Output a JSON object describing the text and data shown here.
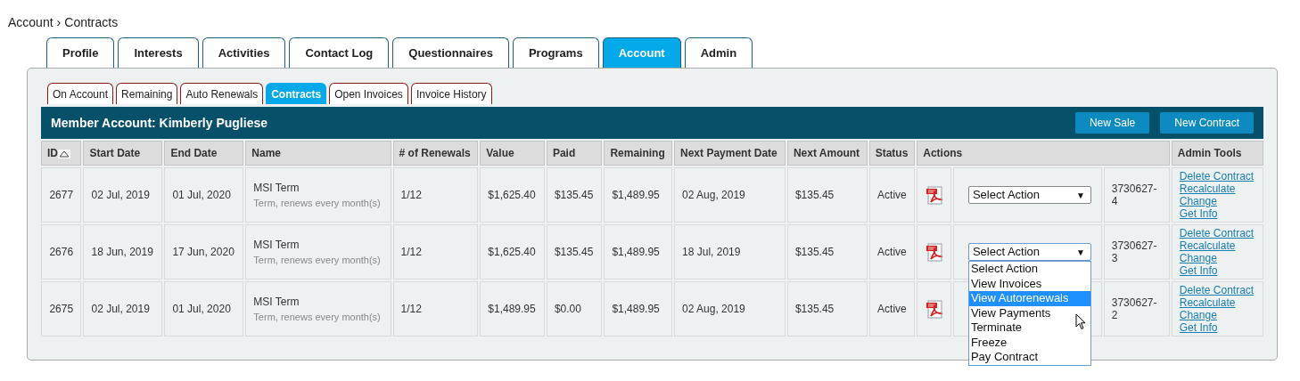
{
  "breadcrumb": {
    "items": [
      "Account",
      "Contracts"
    ],
    "separator": "›"
  },
  "main_tabs": [
    {
      "label": "Profile",
      "selected": false
    },
    {
      "label": "Interests",
      "selected": false
    },
    {
      "label": "Activities",
      "selected": false
    },
    {
      "label": "Contact Log",
      "selected": false
    },
    {
      "label": "Questionnaires",
      "selected": false
    },
    {
      "label": "Programs",
      "selected": false
    },
    {
      "label": "Account",
      "selected": true
    },
    {
      "label": "Admin",
      "selected": false
    }
  ],
  "sub_tabs": [
    {
      "label": "On Account",
      "selected": false
    },
    {
      "label": "Remaining",
      "selected": false
    },
    {
      "label": "Auto Renewals",
      "selected": false
    },
    {
      "label": "Contracts",
      "selected": true
    },
    {
      "label": "Open Invoices",
      "selected": false
    },
    {
      "label": "Invoice History",
      "selected": false
    }
  ],
  "header": {
    "title": "Member Account: Kimberly Pugliese",
    "buttons": [
      "New Sale",
      "New Contract"
    ]
  },
  "table": {
    "columns": [
      "ID",
      "Start Date",
      "End Date",
      "Name",
      "# of Renewals",
      "Value",
      "Paid",
      "Remaining",
      "Next Payment Date",
      "Next Amount",
      "Status",
      "Actions",
      "Admin Tools"
    ],
    "rows": [
      {
        "id": "2677",
        "start": "02 Jul, 2019",
        "end": "01 Jul, 2020",
        "name": "MSI Term",
        "subtitle": "Term, renews every month(s)",
        "renewals": "1/12",
        "value": "$1,625.40",
        "paid": "$135.45",
        "remaining": "$1,489.95",
        "next_payment": "02 Aug, 2019",
        "next_amount": "$135.45",
        "status": "Active",
        "action": "Select Action",
        "open": false,
        "number": "3730627-4",
        "admin_links": [
          "Delete Contract",
          "Recalculate",
          "Change",
          "Get Info"
        ]
      },
      {
        "id": "2676",
        "start": "18 Jun, 2019",
        "end": "17 Jun, 2020",
        "name": "MSI Term",
        "subtitle": "Term, renews every month(s)",
        "renewals": "1/12",
        "value": "$1,625.40",
        "paid": "$135.45",
        "remaining": "$1,489.95",
        "next_payment": "18 Jul, 2019",
        "next_amount": "$135.45",
        "status": "Active",
        "action": "Select Action",
        "open": true,
        "number": "3730627-3",
        "admin_links": [
          "Delete Contract",
          "Recalculate",
          "Change",
          "Get Info"
        ]
      },
      {
        "id": "2675",
        "start": "02 Jul, 2019",
        "end": "01 Jul, 2020",
        "name": "MSI Term",
        "subtitle": "Term, renews every month(s)",
        "renewals": "1/12",
        "value": "$1,489.95",
        "paid": "$0.00",
        "remaining": "$1,489.95",
        "next_payment": "02 Aug, 2019",
        "next_amount": "$135.45",
        "status": "Active",
        "number": "3730627-2",
        "admin_links": [
          "Delete Contract",
          "Recalculate",
          "Change",
          "Get Info"
        ]
      }
    ]
  },
  "dropdown": {
    "arrow": "▼",
    "options": [
      {
        "label": "Select Action",
        "highlighted": false
      },
      {
        "label": "View Invoices",
        "highlighted": false
      },
      {
        "label": "View Autorenewals",
        "highlighted": true
      },
      {
        "label": "View Payments",
        "highlighted": false
      },
      {
        "label": "Terminate",
        "highlighted": false
      },
      {
        "label": "Freeze",
        "highlighted": false
      },
      {
        "label": "Pay Contract",
        "highlighted": false
      }
    ]
  }
}
